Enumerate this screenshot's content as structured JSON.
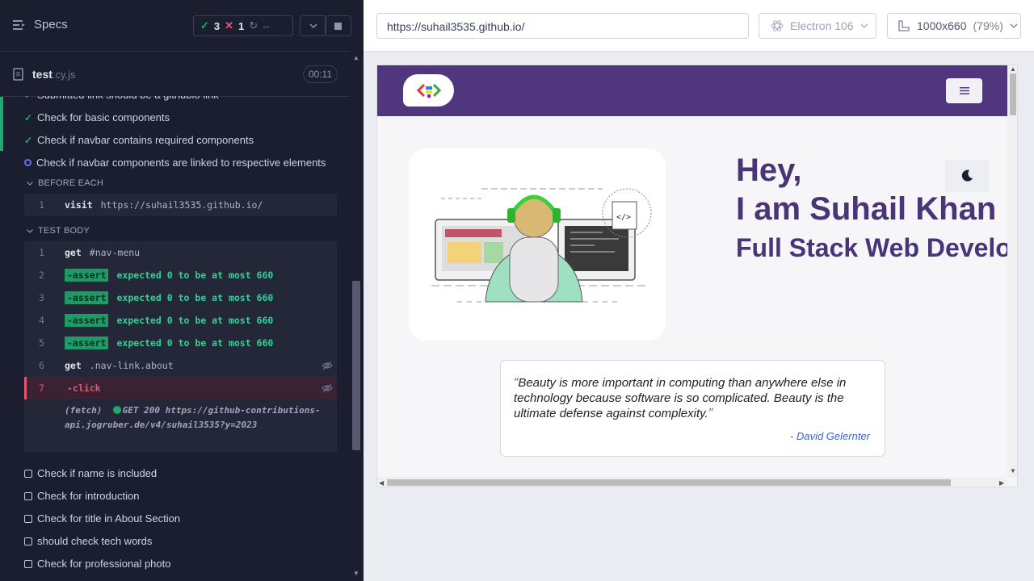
{
  "reporter": {
    "title": "Specs",
    "stats": {
      "passed": "3",
      "failed": "1",
      "pending": "--"
    },
    "spec": {
      "name": "test",
      "ext": ".cy.js",
      "duration": "00:11"
    },
    "tests_top": [
      {
        "label": "Submitted link should be a githubio link",
        "state": "passed"
      },
      {
        "label": "Check for basic components",
        "state": "passed"
      },
      {
        "label": "Check if navbar contains required components",
        "state": "passed"
      },
      {
        "label": "Check if navbar components are linked to respective elements",
        "state": "running"
      }
    ],
    "before_each": {
      "title": "BEFORE EACH",
      "commands": [
        {
          "num": "1",
          "name": "visit",
          "arg": "https://suhail3535.github.io/"
        }
      ]
    },
    "test_body": {
      "title": "TEST BODY",
      "commands": [
        {
          "num": "1",
          "name": "get",
          "arg": "#nav-menu"
        },
        {
          "num": "2",
          "name": "-assert",
          "arg": "expected 0 to be at most 660"
        },
        {
          "num": "3",
          "name": "-assert",
          "arg": "expected 0 to be at most 660"
        },
        {
          "num": "4",
          "name": "-assert",
          "arg": "expected 0 to be at most 660"
        },
        {
          "num": "5",
          "name": "-assert",
          "arg": "expected 0 to be at most 660"
        },
        {
          "num": "6",
          "name": "get",
          "arg": ".nav-link.about"
        },
        {
          "num": "7",
          "name": "-click",
          "arg": ""
        }
      ],
      "fetch_prefix": "(fetch)",
      "fetch_text": "GET 200 https://github-contributions-api.jogruber.de/v4/suhail3535?y=2023"
    },
    "tests_bottom": [
      {
        "label": "Check if name is included"
      },
      {
        "label": "Check for introduction"
      },
      {
        "label": "Check for title in About Section"
      },
      {
        "label": "should check tech words"
      },
      {
        "label": "Check for professional photo"
      }
    ]
  },
  "aut": {
    "url": "https://suhail3535.github.io/",
    "browser": "Electron 106",
    "viewport": "1000x660",
    "zoom": "(79%)",
    "site": {
      "hero_line1": "Hey,",
      "hero_line2": "I am Suhail Khan",
      "hero_line3": "Full Stack Web Developer",
      "quote": "Beauty is more important in computing than anywhere else in technology because software is so complicated. Beauty is the ultimate defense against complexity.",
      "quote_author": "- David Gelernter"
    }
  },
  "colors": {
    "pass": "#1fa971",
    "fail": "#e45770",
    "site_nav": "#50367d",
    "hero_text": "#4a3478"
  }
}
